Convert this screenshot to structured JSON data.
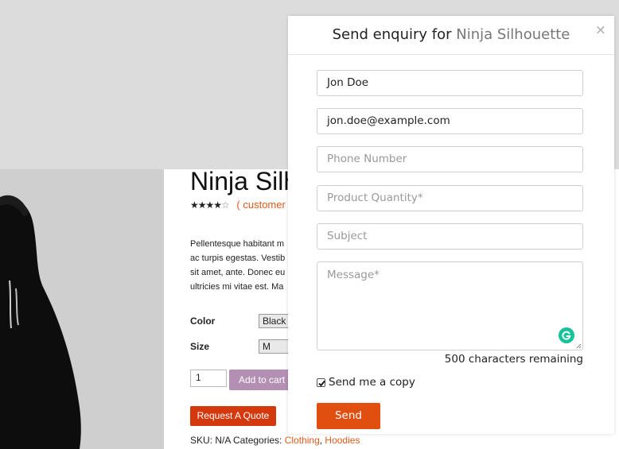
{
  "product": {
    "title": "Ninja Silh",
    "stars": "★★★★",
    "star_empty": "☆",
    "reviews_link": "( customer",
    "description_lines": [
      "Pellentesque habitant m",
      "ac turpis egestas. Vestib",
      "sit amet, ante. Donec eu",
      "ultricies mi vitae est. Ma"
    ],
    "color_label": "Color",
    "color_value": "Black",
    "size_label": "Size",
    "size_value": "M",
    "quantity": "1",
    "add_to_cart": "Add to cart",
    "quote_button": "Request A Quote",
    "meta_prefix": "SKU: N/A Categories: ",
    "categories": [
      "Clothing",
      "Hoodies"
    ],
    "category_separator": ", "
  },
  "modal": {
    "title_prefix": "Send enquiry for ",
    "title_product": "Ninja Silhouette",
    "close_glyph": "×",
    "name_value": "Jon Doe",
    "email_value": "jon.doe@example.com",
    "phone_placeholder": "Phone Number",
    "quantity_placeholder": "Product Quantity*",
    "subject_placeholder": "Subject",
    "message_placeholder": "Message*",
    "chars_remaining": "500 characters remaining",
    "copy_label": "Send me a copy",
    "copy_checked": true,
    "send_label": "Send"
  },
  "colors": {
    "accent": "#e04f10",
    "link": "#e05a1a",
    "grammarly": "#15c39a"
  }
}
